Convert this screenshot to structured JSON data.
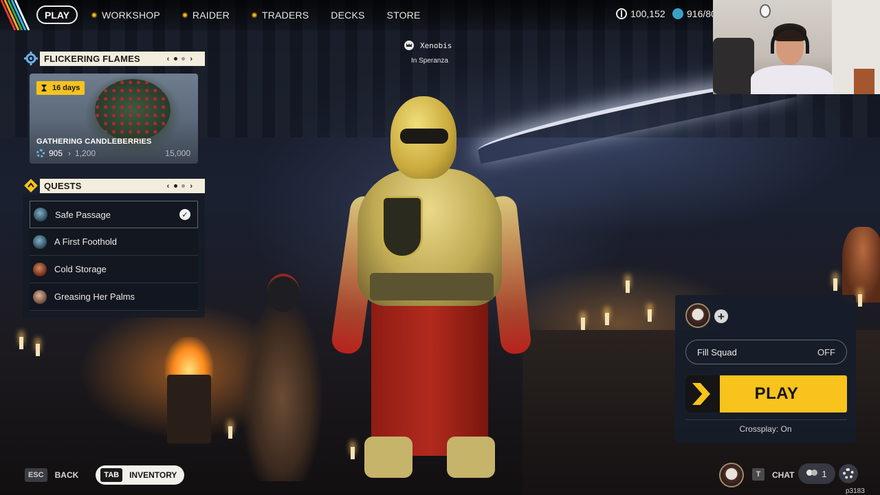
{
  "nav": {
    "play": "PLAY",
    "items": [
      {
        "label": "WORKSHOP",
        "icon": "dot-icon"
      },
      {
        "label": "RAIDER",
        "icon": "dot-icon"
      },
      {
        "label": "TRADERS",
        "icon": "dot-icon"
      },
      {
        "label": "DECKS"
      },
      {
        "label": "STORE"
      }
    ],
    "currency_coins": "100,152",
    "currency_credits": "916/80",
    "accent_color": "#f3b61e"
  },
  "event_panel": {
    "title": "FLICKERING FLAMES",
    "prev": "‹",
    "next": "›",
    "days": "16  days",
    "name": "GATHERING CANDLEBERRIES",
    "progress_current": "905",
    "progress_next": "1,200",
    "progress_max": "15,000"
  },
  "quests": {
    "title": "QUESTS",
    "prev": "‹",
    "next": "›",
    "items": [
      {
        "label": "Safe Passage",
        "completed": true,
        "check": "✓"
      },
      {
        "label": "A First Foothold",
        "completed": false
      },
      {
        "label": "Cold Storage",
        "completed": false
      },
      {
        "label": "Greasing Her Palms",
        "completed": false
      }
    ]
  },
  "player": {
    "name": "Xenobis",
    "location": "In Speranza"
  },
  "squad": {
    "add": "+",
    "fill_label": "Fill Squad",
    "fill_state": "OFF",
    "play_label": "PLAY",
    "crossplay": "Crossplay: On",
    "play_color": "#f7c31c"
  },
  "bottom": {
    "esc_key": "ESC",
    "back_label": "BACK",
    "tab_key": "TAB",
    "inventory_label": "INVENTORY",
    "chat_key": "T",
    "chat_label": "CHAT",
    "friends_count": "1",
    "build_id": "p3183"
  }
}
